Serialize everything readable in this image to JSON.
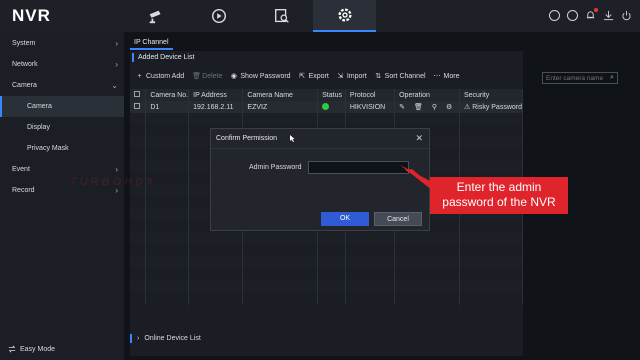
{
  "app": {
    "logo": "NVR"
  },
  "top_nav": [
    {
      "icon": "camera-icon"
    },
    {
      "icon": "playback-icon"
    },
    {
      "icon": "search-file-icon"
    },
    {
      "icon": "gear-icon",
      "active": true
    }
  ],
  "top_right_icons": [
    "info-icon",
    "play-circle-icon",
    "bell-icon",
    "download-icon",
    "power-icon"
  ],
  "sidebar": {
    "items": [
      {
        "label": "System",
        "chevron": "›"
      },
      {
        "label": "Network",
        "chevron": "›"
      },
      {
        "label": "Camera",
        "chevron": "⌄"
      },
      {
        "label": "Camera"
      },
      {
        "label": "Display"
      },
      {
        "label": "Privacy Mask"
      },
      {
        "label": "Event",
        "chevron": "›"
      },
      {
        "label": "Record",
        "chevron": "›"
      }
    ],
    "easy_mode": "Easy Mode"
  },
  "content": {
    "tab": "IP Channel",
    "panel_title": "Added Device List",
    "toolbar": {
      "custom_add": "Custom Add",
      "delete": "Delete",
      "show_password": "Show Password",
      "export": "Export",
      "import": "Import",
      "sort_channel": "Sort Channel",
      "more": "More"
    },
    "search_placeholder": "Enter camera name",
    "columns": [
      "Camera No.",
      "IP Address",
      "Camera Name",
      "Status",
      "Protocol",
      "Operation",
      "Security"
    ],
    "rows": [
      {
        "no": "D1",
        "ip": "192.168.2.11",
        "name": "EZVIZ",
        "status": "online",
        "protocol": "HIKVISION",
        "security": "Risky Password"
      }
    ],
    "online_list": "Online Device List"
  },
  "dialog": {
    "title": "Confirm Permission",
    "label": "Admin Password",
    "ok": "OK",
    "cancel": "Cancel"
  },
  "callout": {
    "text": "Enter the admin password of the NVR"
  },
  "watermark": "TURBOHDX",
  "colors": {
    "accent": "#3a86ff",
    "callout": "#e0242c",
    "ok_button": "#2f5bd4",
    "status_ok": "#2ecc40"
  }
}
